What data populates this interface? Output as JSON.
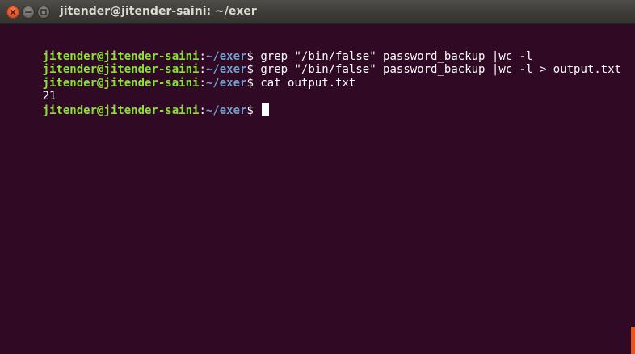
{
  "window": {
    "title": "jitender@jitender-saini: ~/exer",
    "accent_color": "#e95420",
    "background_color": "#300a24"
  },
  "titlebar_buttons": {
    "close": "close-icon",
    "minimize": "minimize-icon",
    "maximize": "maximize-icon"
  },
  "prompt": {
    "user_host": "jitender@jitender-saini",
    "colon": ":",
    "path": "~/exer",
    "symbol": "$",
    "user_color": "#8ae234",
    "path_color": "#729fcf"
  },
  "lines": [
    {
      "type": "command",
      "text": " grep \"/bin/false\" password_backup |wc -l"
    },
    {
      "type": "command",
      "text": " grep \"/bin/false\" password_backup |wc -l > output.txt"
    },
    {
      "type": "command",
      "text": " cat output.txt"
    },
    {
      "type": "output",
      "text": "21"
    },
    {
      "type": "command",
      "text": " "
    }
  ]
}
